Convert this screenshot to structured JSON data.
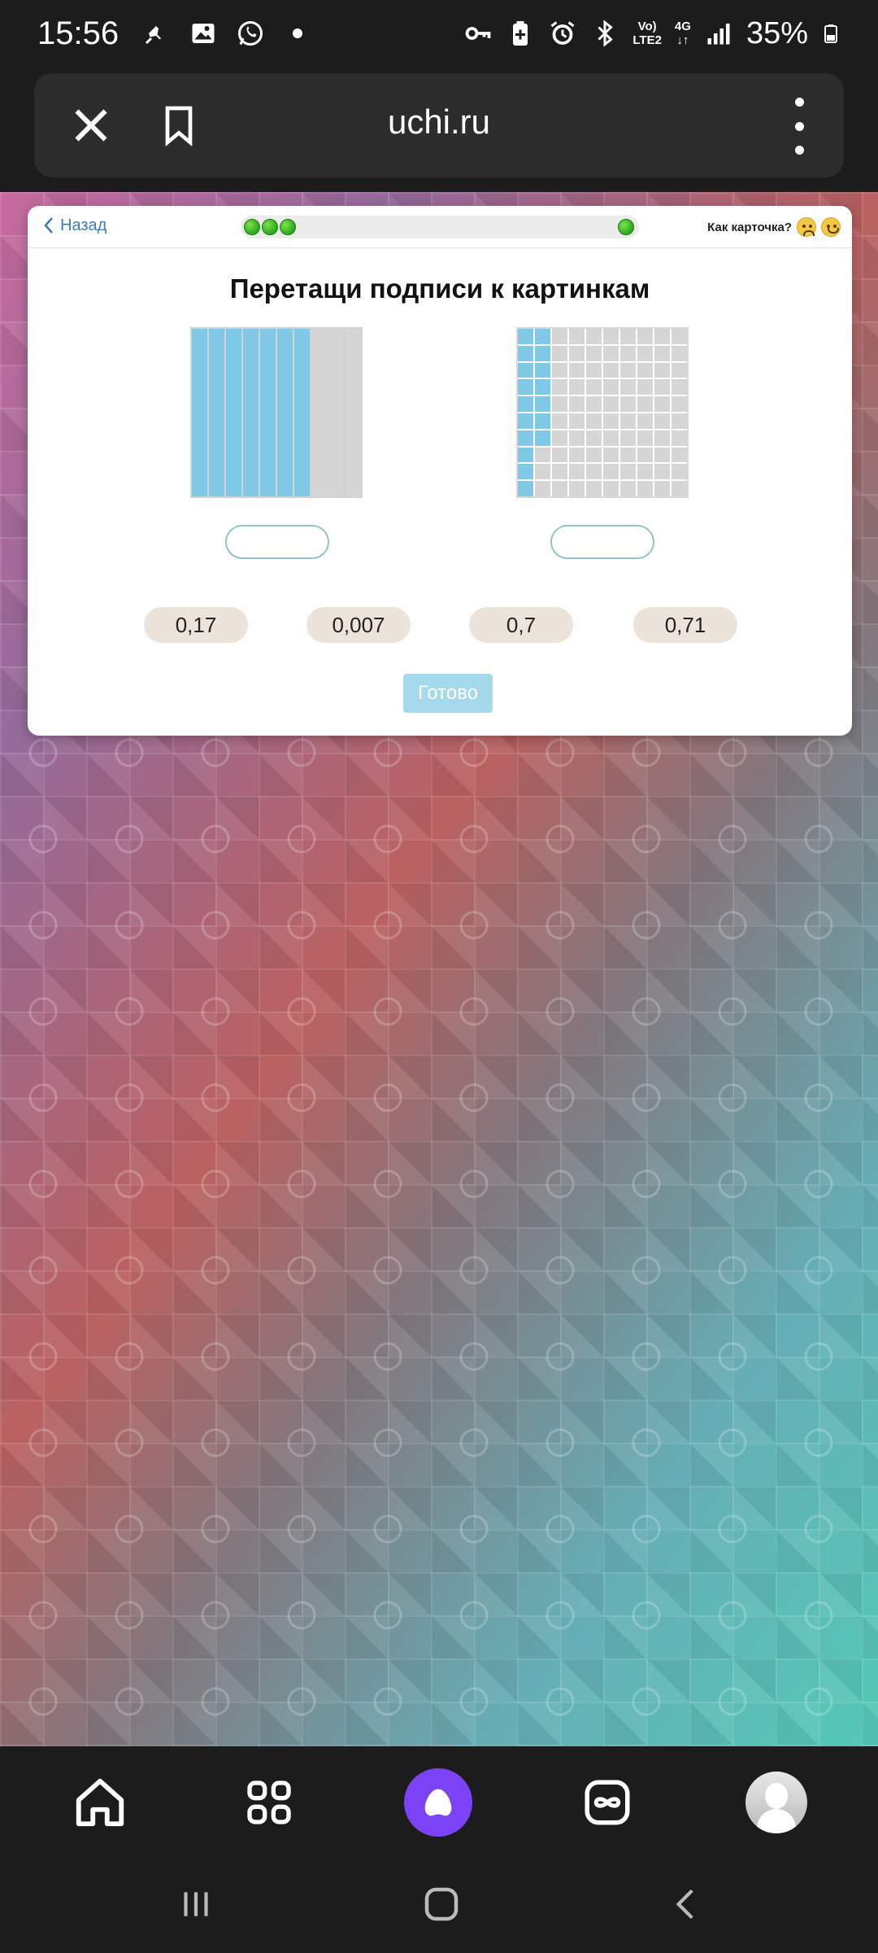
{
  "status_bar": {
    "time": "15:56",
    "lte_top": "Vo)",
    "lte_bottom": "LTE2",
    "network": "4G",
    "battery": "35%"
  },
  "browser": {
    "url": "uchi.ru"
  },
  "card": {
    "back_label": "Назад",
    "feedback_label": "Как карточка?",
    "title": "Перетащи подписи к картинкам",
    "figure_a_filled_columns": 7,
    "figure_a_total_columns": 10,
    "figure_b_filled_cells": 17,
    "figure_b_total_cells": 100,
    "chips": [
      "0,17",
      "0,007",
      "0,7",
      "0,71"
    ],
    "done_label": "Готово"
  },
  "colors": {
    "accent_blue": "#7fc8e6",
    "grid_grey": "#d6d6d6",
    "chip_bg": "#ece4da",
    "alice_purple": "#7b42f6",
    "progress_green": "#27a81a"
  },
  "icons": {
    "close": "close-icon",
    "bookmark": "bookmark-icon",
    "menu": "more-vertical-icon",
    "home": "home-icon",
    "apps": "apps-grid-icon",
    "alice": "alice-assistant-icon",
    "infinity": "infinity-icon",
    "avatar": "avatar-icon"
  }
}
